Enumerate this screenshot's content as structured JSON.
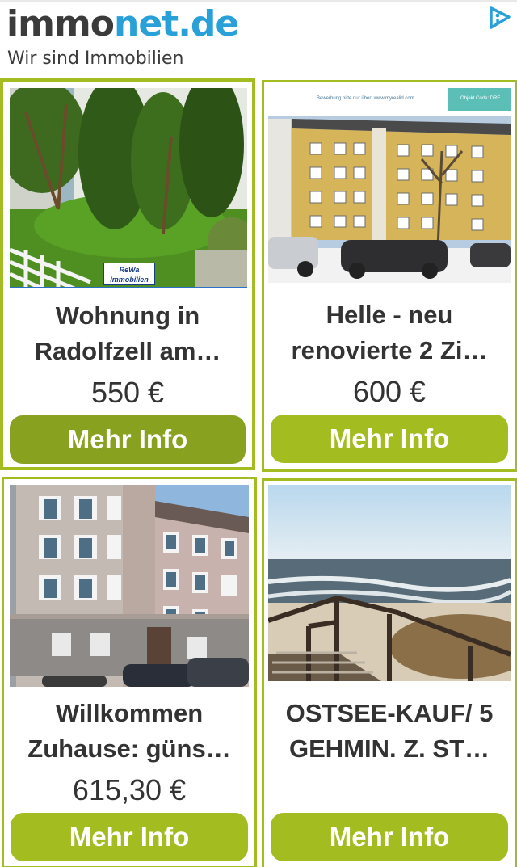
{
  "header": {
    "logo_part1": "immo",
    "logo_part2": "net.de",
    "tagline": "Wir sind Immobilien",
    "adchoices_icon": "adchoices-icon"
  },
  "colors": {
    "accent": "#a3bd21",
    "accent_dark": "#88a11f",
    "logo_gray": "#3b3b3b",
    "logo_blue": "#29a1d8"
  },
  "listings": [
    {
      "title_line1": "Wohnung in",
      "title_line2": "Radolfzell am…",
      "price": "550 €",
      "button": "Mehr Info",
      "image_badge": "ReWa Immobilien"
    },
    {
      "title_line1": "Helle - neu",
      "title_line2": "renovierte 2 Zi…",
      "price": "600 €",
      "button": "Mehr Info",
      "image_banner_left": "Bewerbung bitte nur über: www.myrealid.com",
      "image_banner_right": "Objekt Code: DRE"
    },
    {
      "title_line1": "Willkommen",
      "title_line2": "Zuhause: güns…",
      "price": "615,30 €",
      "button": "Mehr Info"
    },
    {
      "title_line1": "OSTSEE-KAUF/ 5",
      "title_line2": "GEHMIN. Z. ST…",
      "price": "",
      "button": "Mehr Info"
    }
  ]
}
